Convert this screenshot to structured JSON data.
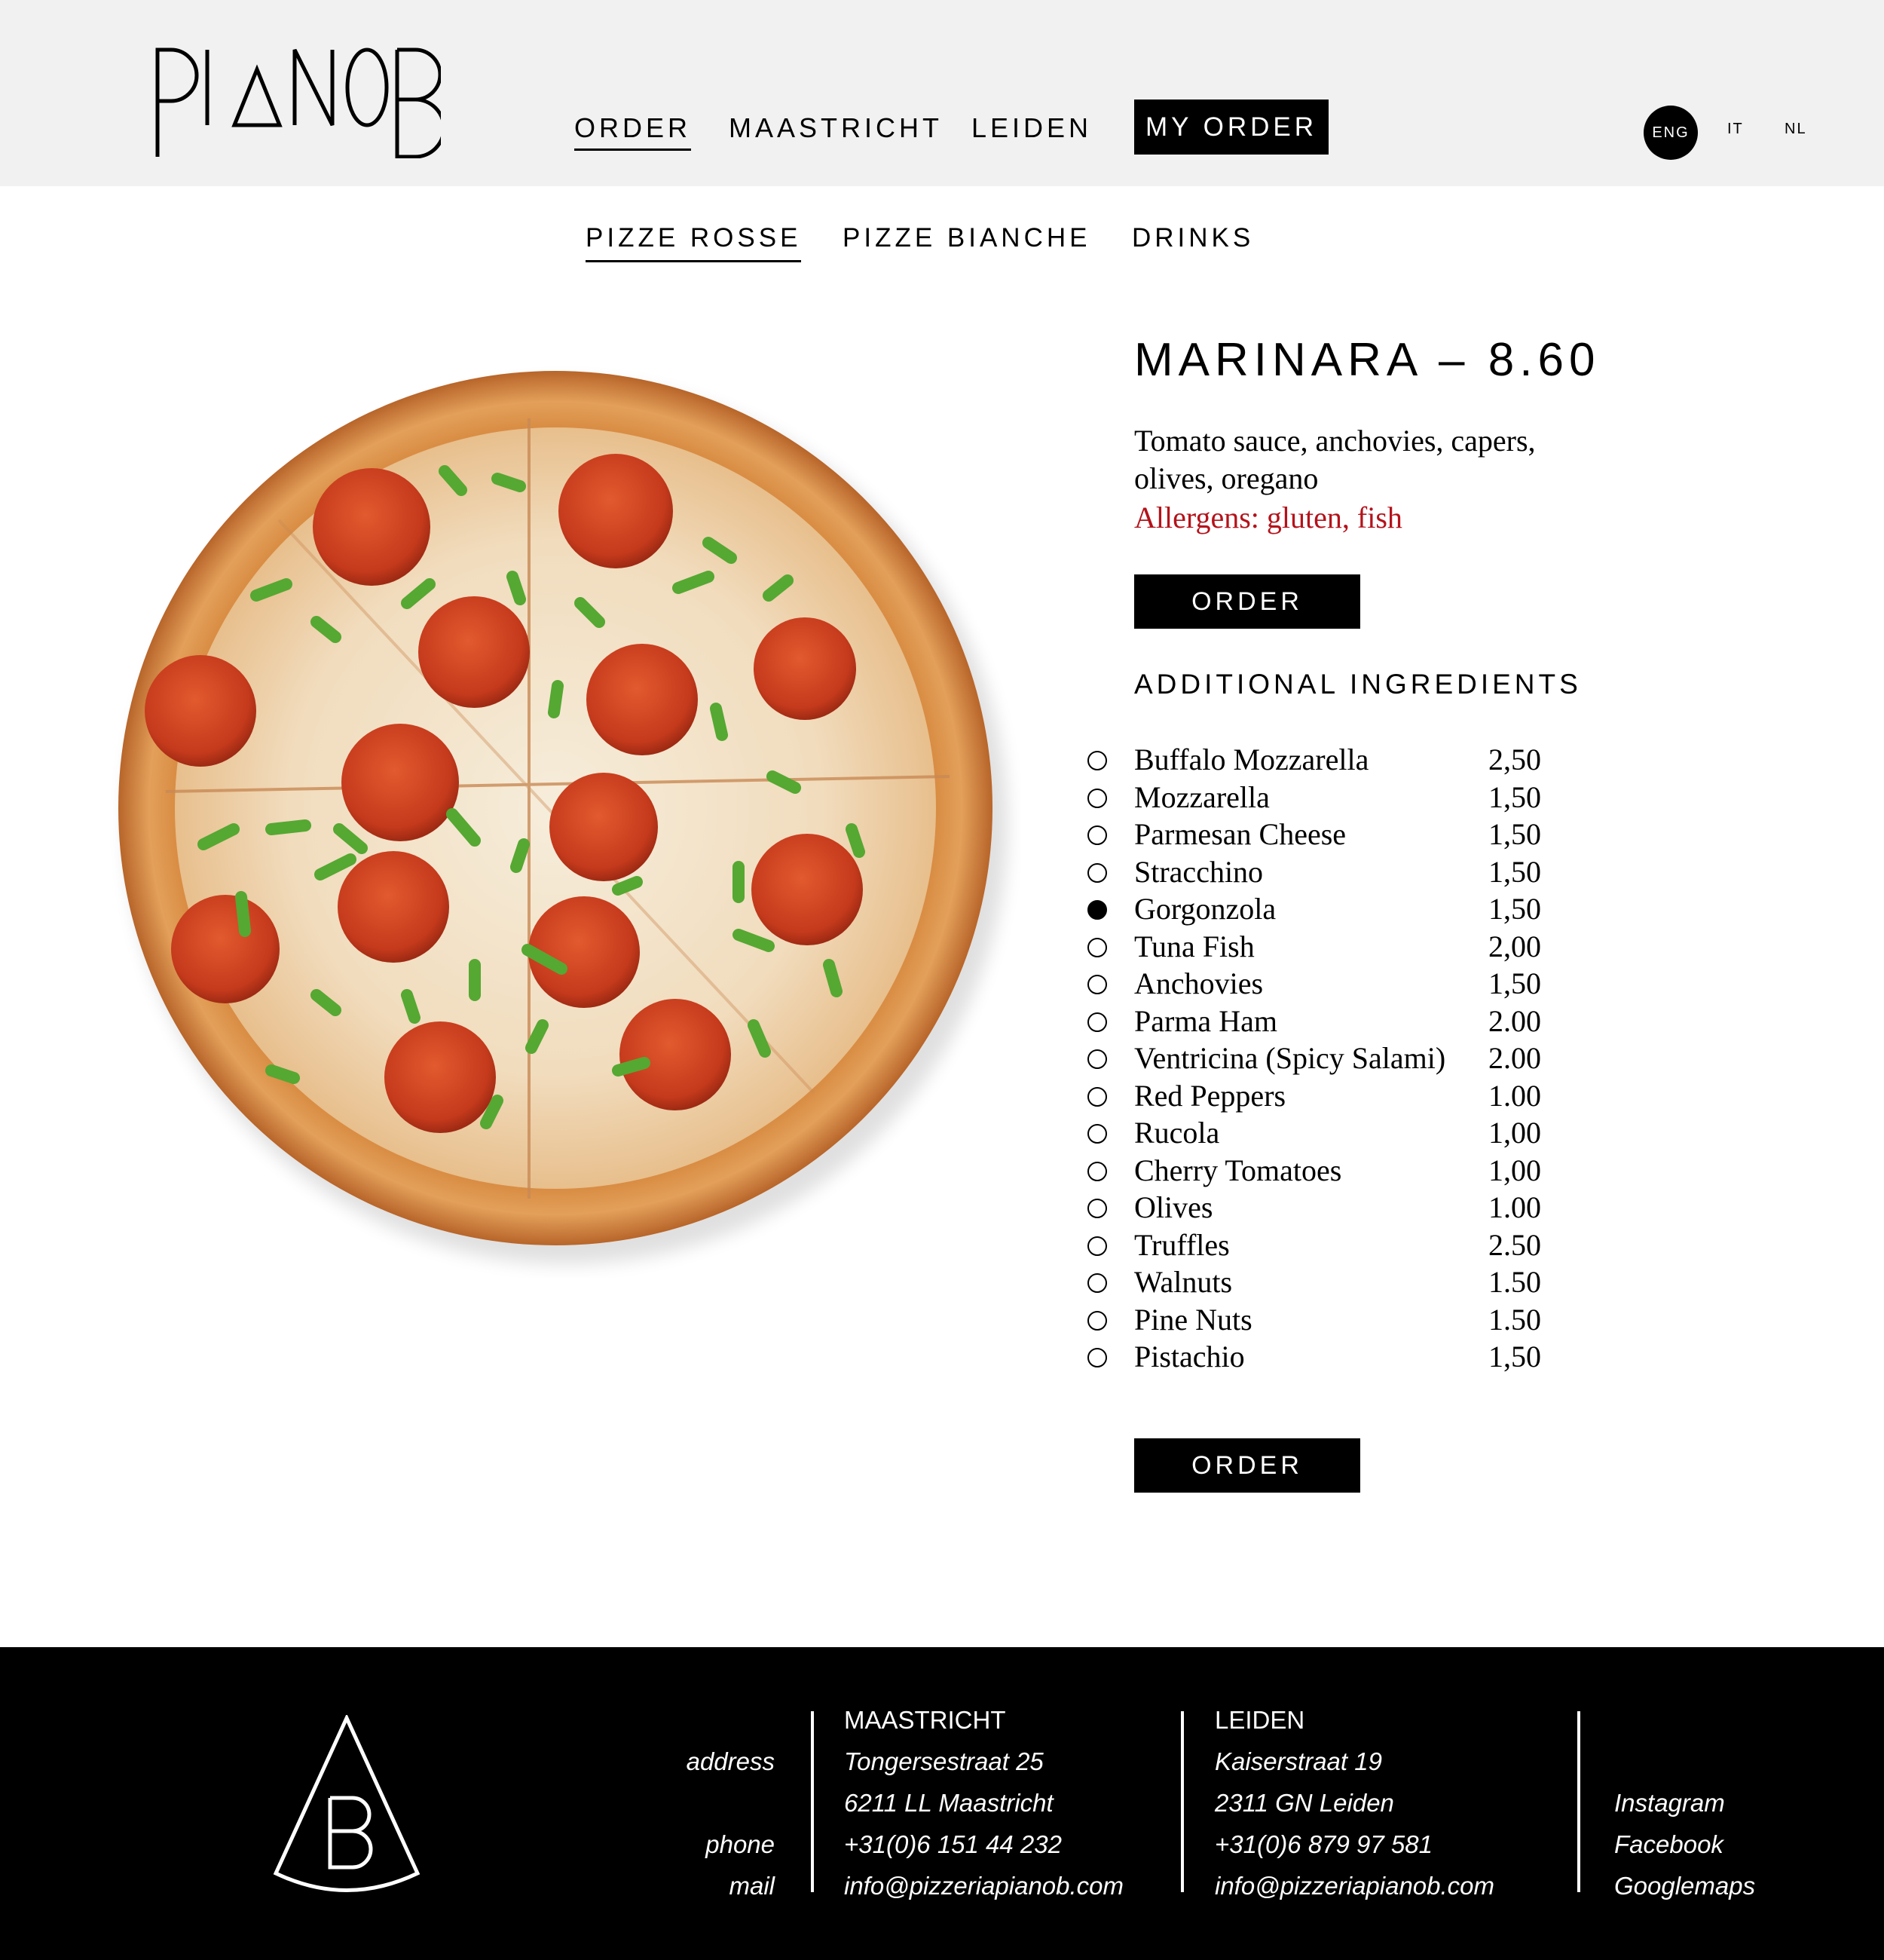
{
  "header": {
    "logo_text": "PIANOB",
    "nav": [
      {
        "label": "ORDER",
        "active": true
      },
      {
        "label": "MAASTRICHT",
        "active": false
      },
      {
        "label": "LEIDEN",
        "active": false
      }
    ],
    "my_order_label": "MY ORDER",
    "languages": [
      {
        "label": "ENG",
        "active": true
      },
      {
        "label": "IT",
        "active": false
      },
      {
        "label": "NL",
        "active": false
      }
    ]
  },
  "subnav": [
    {
      "label": "PIZZE ROSSE",
      "active": true
    },
    {
      "label": "PIZZE BIANCHE",
      "active": false
    },
    {
      "label": "DRINKS",
      "active": false
    }
  ],
  "product": {
    "title": "MARINARA – 8.60",
    "description": "Tomato sauce, anchovies, capers, olives, oregano",
    "allergens": "Allergens: gluten, fish",
    "order_label": "ORDER",
    "additional_title": "ADDITIONAL INGREDIENTS",
    "ingredients": [
      {
        "name": "Buffalo Mozzarella",
        "price": "2,50",
        "selected": false
      },
      {
        "name": "Mozzarella",
        "price": "1,50",
        "selected": false
      },
      {
        "name": "Parmesan Cheese",
        "price": "1,50",
        "selected": false
      },
      {
        "name": "Stracchino",
        "price": "1,50",
        "selected": false
      },
      {
        "name": "Gorgonzola",
        "price": "1,50",
        "selected": true
      },
      {
        "name": "Tuna Fish",
        "price": "2,00",
        "selected": false
      },
      {
        "name": "Anchovies",
        "price": "1,50",
        "selected": false
      },
      {
        "name": "Parma Ham",
        "price": "2.00",
        "selected": false
      },
      {
        "name": "Ventricina (Spicy Salami)",
        "price": "2.00",
        "selected": false
      },
      {
        "name": "Red Peppers",
        "price": "1.00",
        "selected": false
      },
      {
        "name": "Rucola",
        "price": "1,00",
        "selected": false
      },
      {
        "name": "Cherry Tomatoes",
        "price": "1,00",
        "selected": false
      },
      {
        "name": "Olives",
        "price": "1.00",
        "selected": false
      },
      {
        "name": "Truffles",
        "price": "2.50",
        "selected": false
      },
      {
        "name": "Walnuts",
        "price": "1.50",
        "selected": false
      },
      {
        "name": "Pine Nuts",
        "price": "1.50",
        "selected": false
      },
      {
        "name": "Pistachio",
        "price": "1,50",
        "selected": false
      }
    ],
    "order_label_bottom": "ORDER"
  },
  "footer": {
    "labels": {
      "address": "address",
      "phone": "phone",
      "mail": "mail"
    },
    "maastricht": {
      "city": "MAASTRICHT",
      "street": "Tongersestraat 25",
      "postcode": "6211  LL  Maastricht",
      "phone": "+31(0)6 151 44 232",
      "mail": "info@pizzeriapianob.com"
    },
    "leiden": {
      "city": "LEIDEN",
      "street": "Kaiserstraat 19",
      "postcode": "2311 GN  Leiden",
      "phone": "+31(0)6 879 97 581",
      "mail": "info@pizzeriapianob.com"
    },
    "social": [
      "Instagram",
      "Facebook",
      "Googlemaps"
    ]
  },
  "colors": {
    "header_bg": "#f1f1f1",
    "allergen_red": "#b4121a",
    "black": "#000000"
  }
}
